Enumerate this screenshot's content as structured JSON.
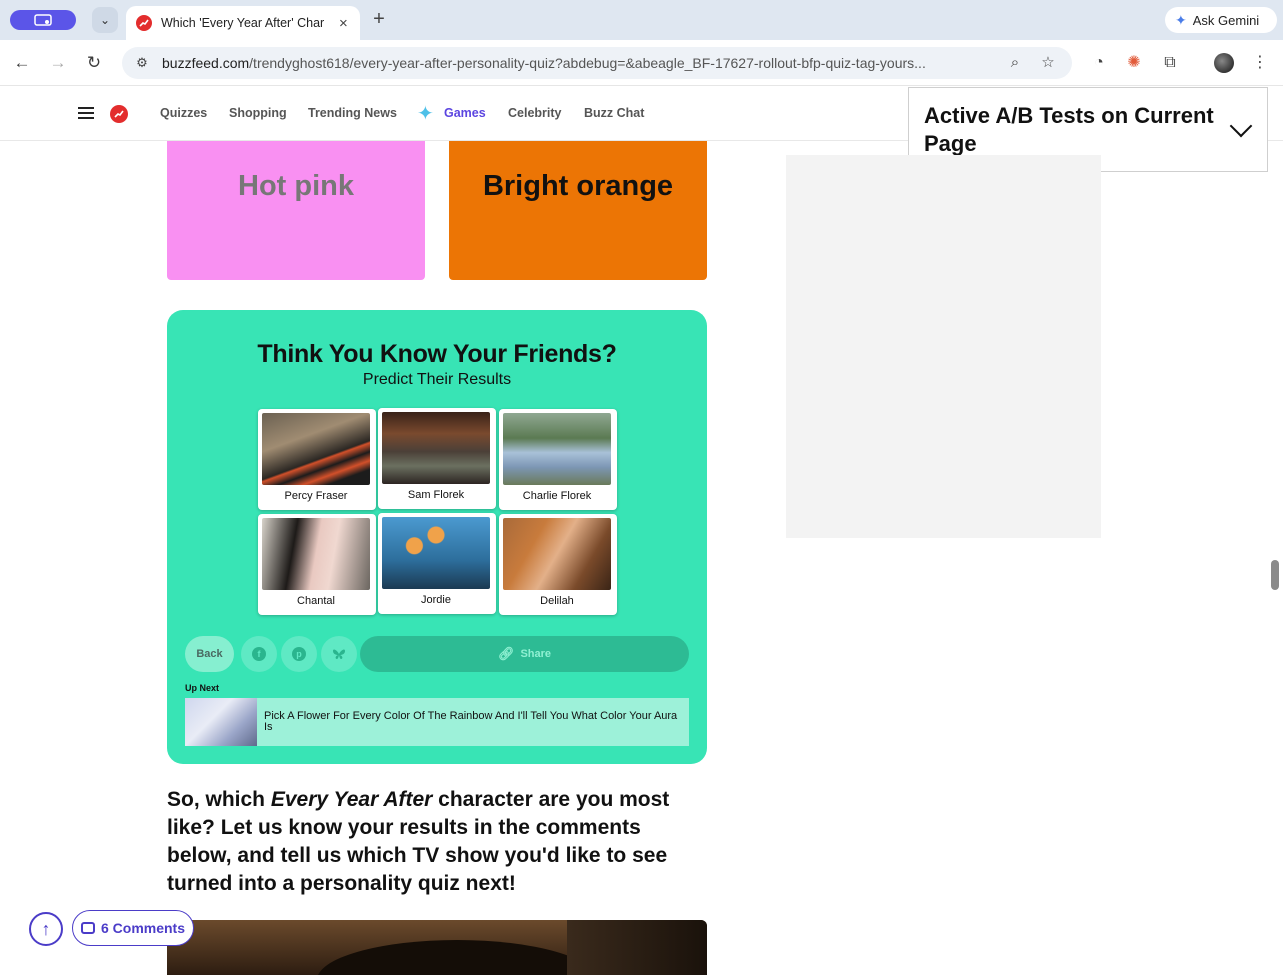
{
  "browser": {
    "tab_title": "Which 'Every Year After' Char",
    "tab_close": "×",
    "new_tab": "+",
    "gemini_label": "Ask Gemini",
    "url_host": "buzzfeed.com",
    "url_path": "/trendyghost618/every-year-after-personality-quiz?abdebug=&abeagle_BF-17627-rollout-bfp-quiz-tag-yours..."
  },
  "site_nav": {
    "items": [
      "Quizzes",
      "Shopping",
      "Trending News",
      "Games",
      "Celebrity",
      "Buzz Chat"
    ]
  },
  "ab_panel": {
    "title": "Active A/B Tests on Current Page"
  },
  "answers": [
    {
      "label": "Hot pink",
      "color": "#f990f2"
    },
    {
      "label": "Bright orange",
      "color": "#ec7505"
    }
  ],
  "quiz_card": {
    "title": "Think You Know Your Friends?",
    "subtitle": "Predict Their Results",
    "friends": [
      "Percy Fraser",
      "Sam Florek",
      "Charlie Florek",
      "Chantal",
      "Jordie",
      "Delilah"
    ],
    "back_label": "Back",
    "share_label": "Share",
    "social_icons": [
      "facebook-icon",
      "pinterest-icon",
      "bluesky-icon"
    ],
    "up_next_label": "Up Next",
    "up_next_title": "Pick A Flower For Every Color Of The Rainbow And I'll Tell You What Color Your Aura Is",
    "accent_color": "#38e4b5"
  },
  "article": {
    "closing_prefix": "So, which ",
    "closing_italic": "Every Year After",
    "closing_suffix": " character are you most like? Let us know your results in the comments below, and tell us which TV show you'd like to see turned into a personality quiz next!"
  },
  "floating": {
    "scroll_top": "↑",
    "comments_label": "6 Comments"
  }
}
